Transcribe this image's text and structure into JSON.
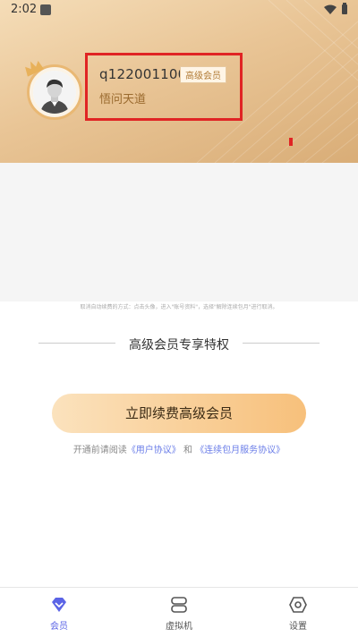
{
  "status_bar": {
    "time": "2:02"
  },
  "profile": {
    "username": "q122001100",
    "badge": "高级会员",
    "nickname": "悟问天道"
  },
  "notice": {
    "fine_print": "取消自动续费的方式：点击头像，进入\"账号资料\"，选择\"解除连续包月\"进行取消。"
  },
  "section": {
    "title": "高级会员专享特权"
  },
  "cta": {
    "renew_label": "立即续费高级会员"
  },
  "agreement": {
    "prefix": "开通前请阅读",
    "user_agreement": "《用户协议》",
    "conjunction": "和",
    "renewal_agreement": "《连续包月服务协议》"
  },
  "tabs": [
    {
      "label": "会员",
      "icon": "diamond-icon",
      "active": true
    },
    {
      "label": "虚拟机",
      "icon": "server-icon",
      "active": false
    },
    {
      "label": "设置",
      "icon": "hexagon-settings-icon",
      "active": false
    }
  ],
  "colors": {
    "accent": "#5b64e6",
    "gold": "#e9c596",
    "highlight_box": "#e02424"
  }
}
